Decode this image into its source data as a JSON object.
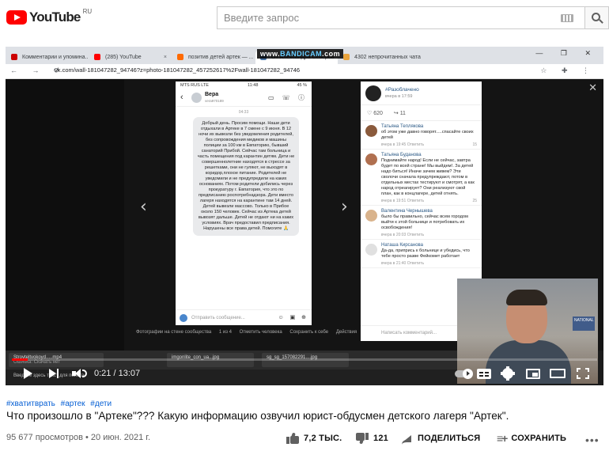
{
  "header": {
    "logo_text": "YouTube",
    "region": "RU",
    "search_placeholder": "Введите запрос"
  },
  "recording": {
    "tabs": [
      {
        "label": "Комментарии и упомина...",
        "color": "#cc0000"
      },
      {
        "label": "(285) YouTube",
        "color": "#ff0000"
      },
      {
        "label": "позитив детей артек — ...",
        "color": "#ff6a00"
      },
      {
        "label": "От Александра Северов",
        "color": "#4a76a8"
      },
      {
        "label": "4302 непрочитанных чата",
        "color": "#e8a33d"
      }
    ],
    "watermark_a": "www.",
    "watermark_b": "BANDICAM",
    "watermark_c": ".com",
    "url": "vk.com/wall-181047282_94746?z=photo-181047282_457252617%2Fwall-181047282_94746",
    "phone": {
      "carrier": "MTS RUS LTE",
      "clock": "11:48",
      "battery": "45 %",
      "contact": "Вера",
      "contact_sub": "vera970189",
      "date_sep": "04:33",
      "message": "Добрый день. Просим помощи. Наши дети отдыхали в Артеке в 7 смене с 9 июня. В 12 ночи их вывезли без уведомления родителей, без сопровождения медиков и машины полиции за 100 км в Евпаторию, бывший санаторий Прибой. Сейчас там больница и часть помещения под карантин детям. Дети не совершеннолетние находятся в стрессе за решетками, они не гуляют, не выходят в коридор,плохое питание. Родителей не уведомили и не предупредили на каких основаниях. Потом родители добились через прокуратуру г. Евпатория, что это по предписанию роспотребнадзора. Дети вместо лагеря находятся на карантине там 14 дней. Детей вывезли массово. Только в Прибое около 150 человек. Сейчас из Артека детей вывозят дальше. Детей не отдают ни на каких условиях. Врач предоставил предписания. Нарушены все права детей. Помогите 🙏",
      "input_placeholder": "Отправить сообщение..."
    },
    "vk_caption": "Фотографии на стене сообщества",
    "vk_counter": "1 из 4",
    "vk_caption_links": [
      "Отметить человека",
      "Сохранить к себе",
      "Действия"
    ],
    "panel": {
      "author": "#Разоблачено",
      "date": "вчера в 17:59",
      "likes": "620",
      "shares": "11",
      "comments": [
        {
          "name": "Татьяна Теплякова",
          "text": "об этом уже давно говорят.....спасайте своих детей",
          "meta": "вчера в 19:45  Ответить",
          "likes": "15",
          "color": "#8a5a3c"
        },
        {
          "name": "Татьяна Буданова",
          "text": "Поднимайте народ! Если не сейчас, завтра будет по всей стране! Мы выйдем!. За детей надо биться! Иначе зачем живем? Эти сволочи сначала предупреждают, потом в отдельных местах тестируют и смотрят, а как народ отреагирует? Они реализуют свой план, как в концлагере, детей отнять.",
          "meta": "вчера в 19:51  Ответить",
          "likes": "25",
          "color": "#b07050"
        },
        {
          "name": "Валентина Чернышева",
          "text": "было бы правильно, сейчас всем городом выйти к этой больнице и потребовать их освобождения!",
          "meta": "вчера в 20:03  Ответить",
          "likes": "",
          "color": "#d9b38c"
        },
        {
          "name": "Наташа Кирсанова",
          "text": "Да-да, припрись к больнице и убедись, что тебе просто разве Фейкомет работает",
          "meta": "вчера в 21:40  Ответить",
          "likes": "",
          "color": "#e0e0e0"
        }
      ],
      "input_placeholder": "Написать комментарий..."
    },
    "downloads": [
      {
        "label": "Stroyteltvokoyd.....mp4",
        "sub": "Ошибка: Скачать нет"
      },
      {
        "label": "imgonlite_con_ua...jpg",
        "sub": ""
      },
      {
        "label": "sg_sg_157082291....jpg",
        "sub": ""
      }
    ],
    "start_hint": "Введите здесь текст для поиска",
    "webcam_sticker": "NATIONAL"
  },
  "player": {
    "time": "0:21 / 13:07",
    "progress_fraction": 0.027
  },
  "video": {
    "hashtags": [
      "#хватитврать",
      "#артек",
      "#дети"
    ],
    "title": "Что произошло в \"Артеке\"??? Какую информацию озвучил юрист-обдусмен детского лагеря \"Артек\".",
    "views": "95 677 просмотров • 20 июн. 2021 г.",
    "likes": "7,2 ТЫС.",
    "dislikes": "121",
    "share_label": "ПОДЕЛИТЬСЯ",
    "save_label": "СОХРАНИТЬ"
  },
  "colors": {
    "youtube_red": "#ff0000",
    "link_blue": "#065fd4",
    "vk_blue": "#2a5885"
  }
}
